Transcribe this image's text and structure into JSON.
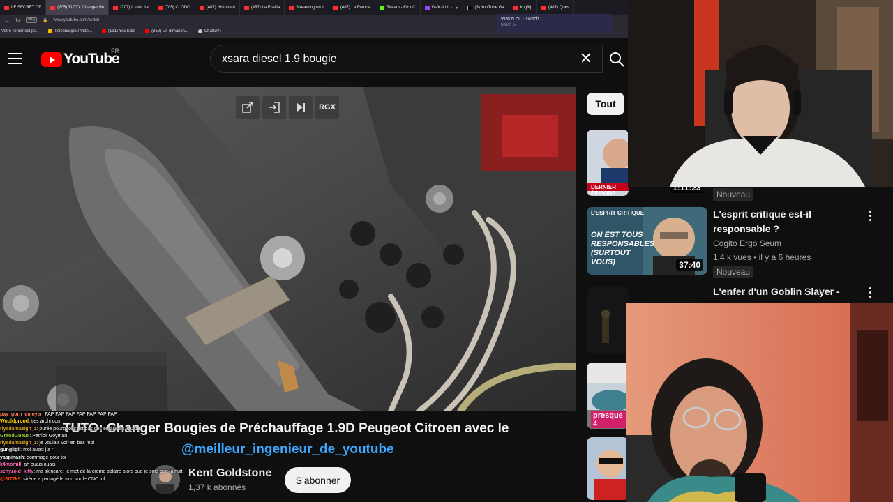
{
  "browser": {
    "tabs": [
      {
        "label": "LE SECRET DE",
        "favicon": "youtube"
      },
      {
        "label": "(705) TUTO: Changer Bo",
        "favicon": "youtube",
        "active": true
      },
      {
        "label": "(707) Il veut fra",
        "favicon": "youtube"
      },
      {
        "label": "(705) CLODO",
        "favicon": "youtube"
      },
      {
        "label": "(487) Histoire d",
        "favicon": "youtube"
      },
      {
        "label": "(487) La Fusilla",
        "favicon": "youtube"
      },
      {
        "label": "Streaming en d",
        "favicon": "youtube"
      },
      {
        "label": "(487) La France",
        "favicon": "youtube"
      },
      {
        "label": "Stream - Kick C",
        "favicon": "kick"
      },
      {
        "label": "WaKzLoL -",
        "favicon": "twitch"
      },
      {
        "label": "(3) YouTube Ga",
        "favicon": "x"
      },
      {
        "label": "imgflip",
        "favicon": "imgflip"
      },
      {
        "label": "(487) Ques",
        "favicon": "youtube"
      }
    ],
    "url": "www.youtube.com/watch",
    "vpn_label": "VPN",
    "bookmarks": [
      "Votre fichier est pr...",
      "Téléchargeur Vidé...",
      "(191) YouTube",
      "(352) Un dimanch...",
      "ChatGPT"
    ],
    "tooltip": {
      "title": "WakzLoL - Twitch",
      "url": "twitch.tv"
    }
  },
  "youtube": {
    "logo_text": "YouTube",
    "country_code": "FR",
    "search_query": "xsara diesel 1.9 bougie",
    "video_controls": [
      "RGX"
    ],
    "video": {
      "title_line1": "TUTO: Changer Bougies de Préchauffage 1.9D Peugeot Citroen avec le",
      "title_line2": "@meilleur_ingenieur_de_youtube",
      "channel": "Kent Goldstone",
      "subscribers": "1,37 k abonnés",
      "subscribe_label": "S'abonner"
    },
    "chip_all": "Tout",
    "recommendations": [
      {
        "duration": "1:11:23",
        "badge": "Nouveau",
        "thumb_caption": "DERNIER ÉPISODE"
      },
      {
        "title": "L'esprit critique est-il responsable ?",
        "channel": "Cogito Ergo Seum",
        "meta": "1,4 k vues • il y a 6 heures",
        "duration": "37:40",
        "badge": "Nouveau",
        "thumb_caption": "L'ESPRIT CRITIQUE",
        "thumb_text": "ON EST TOUS RESPONSABLES (SURTOUT VOUS)"
      },
      {
        "title": "L'enfer d'un Goblin Slayer -"
      },
      {
        "thumb_caption": "presque 4"
      }
    ]
  },
  "chat": [
    {
      "user": "pay_gorn_enjoyer",
      "color": "#ff7f50",
      "msg": "FAP FAP FAP FAP FAP FAP FAP"
    },
    {
      "user": "Wooldprood",
      "color": "#ffd700",
      "msg": "t'es archi con"
    },
    {
      "user": "riyadamazigh_1",
      "color": "#daa520",
      "msg": "purée pourquoi c'est pas des emails au lieu de"
    },
    {
      "user": "GrandGueux",
      "color": "#9acd32",
      "msg": "Patrick Goyman"
    },
    {
      "user": "riyadamazigh_1",
      "color": "#daa520",
      "msg": "je voulais voir en bas moi"
    },
    {
      "user": "gungligli",
      "color": "#ffffff",
      "msg": "moi aussi j a r"
    },
    {
      "user": "yaspinach",
      "color": "#ffffff",
      "msg": "dommage pour toi"
    },
    {
      "user": "k4momill",
      "color": "#ff69b4",
      "msg": "ah ouais ouais"
    },
    {
      "user": "schyzoid_kitty",
      "color": "#ff69b4",
      "msg": "ma skincare: je met de la crème solaire alors que je sors que la nuit"
    },
    {
      "user": "@SIT2k9",
      "color": "#ff4500",
      "msg": "sirène a partagé le truc sur le CNC lol"
    }
  ]
}
